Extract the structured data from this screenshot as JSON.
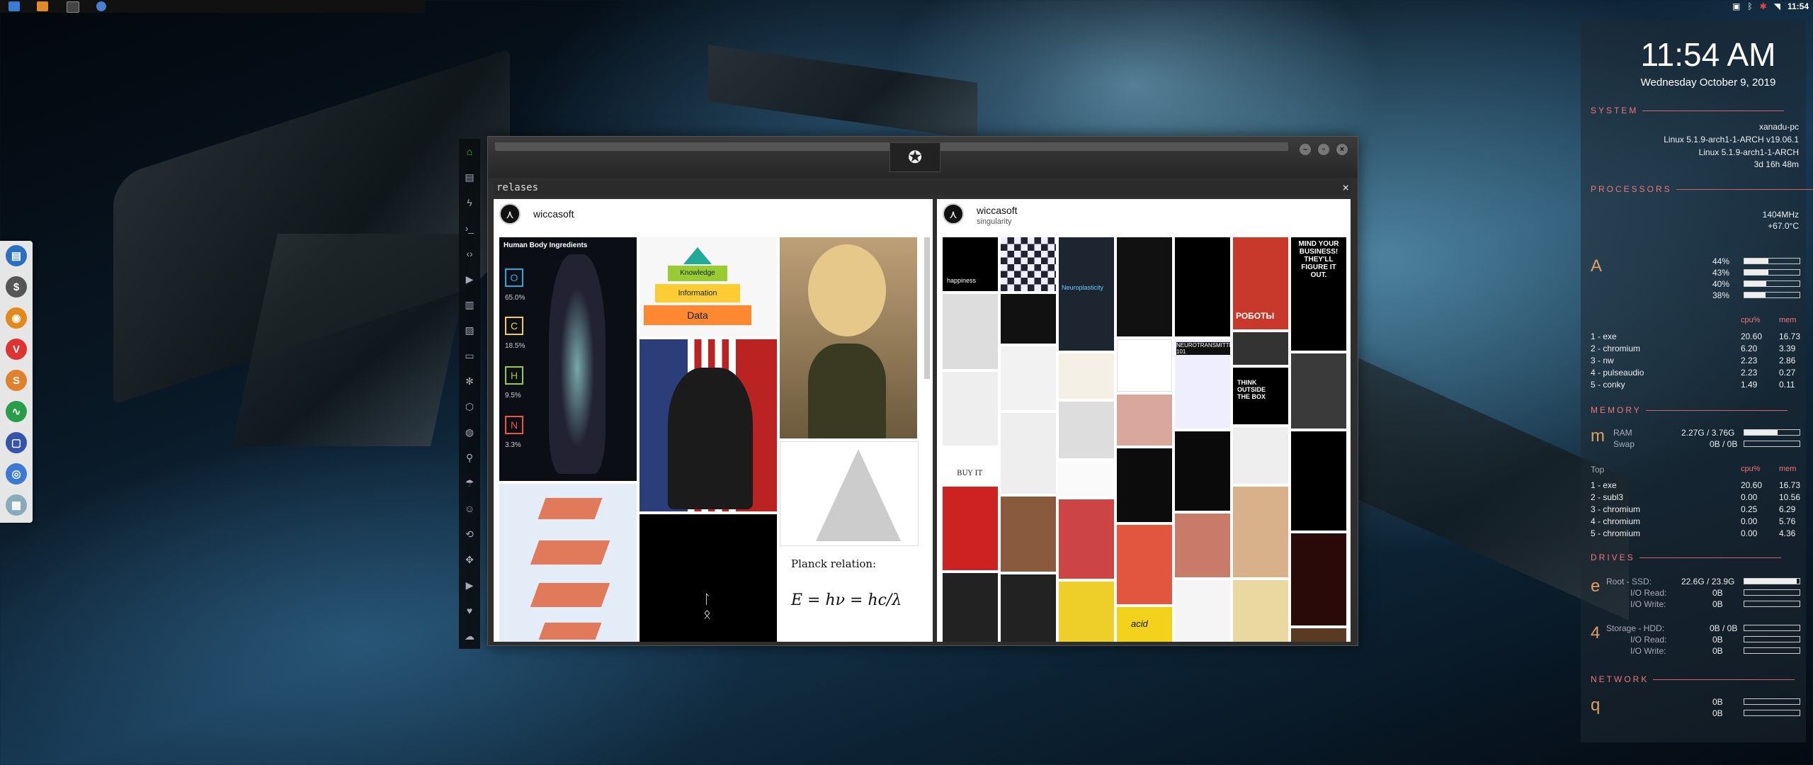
{
  "tray": {
    "time": "11:54"
  },
  "window": {
    "inner_title": "relases"
  },
  "panel_left": {
    "user": "wiccasoft",
    "pyramid_label_data": "Data",
    "pyramid_label_info": "Information",
    "pyramid_label_knowledge": "Knowledge",
    "planck_title": "Planck relation:",
    "planck_formula": "E = hν = hc/λ",
    "science_title": "Human Body Ingredients",
    "element_o": "O",
    "element_c": "C",
    "element_h": "H",
    "element_n": "N",
    "pct_o": "65.0%",
    "pct_c": "18.5%",
    "pct_h": "9.5%",
    "pct_n": "3.3%"
  },
  "panel_right": {
    "user": "wiccasoft",
    "subtitle": "singularity",
    "tile_happiness": "happiness",
    "tile_neuroplasticity": "Neuroplasticity",
    "tile_poster": "MIND YOUR BUSINESS! THEY'LL FIGURE IT OUT.",
    "tile_roboty": "РОБОТЫ",
    "tile_think": "THINK OUTSIDE THE BOX",
    "tile_neuro": "NEUROTRANSMITTERS 101",
    "tile_buy": "BUY IT",
    "tile_acid": "acid"
  },
  "conky": {
    "clock": "11:54 AM",
    "date": "Wednesday October 9, 2019",
    "system_header": "SYSTEM",
    "hostname": "xanadu-pc",
    "kernel1": "Linux 5.1.9-arch1-1-ARCH v19.06.1",
    "kernel2": "Linux 5.1.9-arch1-1-ARCH",
    "uptime": "3d 16h 48m",
    "proc_header": "PROCESSORS",
    "freq": "1404MHz",
    "temp": "+67.0°C",
    "proc_letter": "A",
    "cpu": [
      "44%",
      "43%",
      "40%",
      "38%"
    ],
    "cpu_fill": [
      0.44,
      0.43,
      0.4,
      0.38
    ],
    "cpu_cols": [
      "cpu%",
      "mem"
    ],
    "cpu_procs": [
      {
        "name": "1 - exe",
        "cpu": "20.60",
        "mem": "16.73"
      },
      {
        "name": "2 - chromium",
        "cpu": "6.20",
        "mem": "3.39"
      },
      {
        "name": "3 - nw",
        "cpu": "2.23",
        "mem": "2.86"
      },
      {
        "name": "4 - pulseaudio",
        "cpu": "2.23",
        "mem": "0.27"
      },
      {
        "name": "5 - conky",
        "cpu": "1.49",
        "mem": "0.11"
      }
    ],
    "mem_header": "MEMORY",
    "mem_letter": "m",
    "ram_label": "RAM",
    "swap_label": "Swap",
    "ram": "2.27G / 3.76G",
    "ram_fill": 0.6,
    "swap": "0B / 0B",
    "mem_top_label": "Top",
    "mem_cols": [
      "cpu%",
      "mem"
    ],
    "mem_procs": [
      {
        "name": "1 - exe",
        "cpu": "20.60",
        "mem": "16.73"
      },
      {
        "name": "2 - subl3",
        "cpu": "0.00",
        "mem": "10.56"
      },
      {
        "name": "3 - chromium",
        "cpu": "0.25",
        "mem": "6.29"
      },
      {
        "name": "4 - chromium",
        "cpu": "0.00",
        "mem": "5.76"
      },
      {
        "name": "5 - chromium",
        "cpu": "0.00",
        "mem": "4.36"
      }
    ],
    "drives_header": "DRIVES",
    "drive_letter1": "e",
    "drive_letter2": "4",
    "root_label": "Root  -  SSD:",
    "root_val": "22.6G / 23.9G",
    "root_fill": 0.95,
    "io_read": "I/O Read:",
    "io_write": "I/O Write:",
    "io_val": "0B",
    "storage_label": "Storage  -  HDD:",
    "storage_val": "0B / 0B",
    "net_header": "NETWORK",
    "net_letter": "q",
    "net_val": "0B"
  }
}
